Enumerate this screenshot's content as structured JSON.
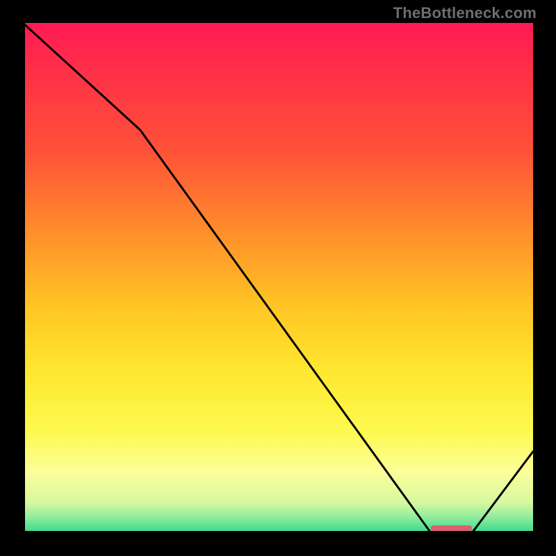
{
  "watermark": "TheBottleneck.com",
  "colors": {
    "background": "#000000",
    "watermark_text": "#6e6e6e",
    "curve": "#000000",
    "marker": "#d9606d"
  },
  "chart_data": {
    "type": "line",
    "title": "",
    "xlabel": "",
    "ylabel": "",
    "xlim": [
      0,
      100
    ],
    "ylim": [
      0,
      100
    ],
    "grid": false,
    "legend": false,
    "x": [
      0,
      23,
      80,
      88,
      100
    ],
    "values": [
      100,
      79,
      0,
      0,
      16
    ],
    "note": "x and values are in percent of plot size; y=0 means curve touches bottom (green), y=100 top (red).",
    "marker_segment": {
      "x_start": 80,
      "x_end": 88,
      "y": 0
    },
    "gradient_stops": [
      {
        "pos": 0,
        "color": "#ff1a56"
      },
      {
        "pos": 8,
        "color": "#ff2d49"
      },
      {
        "pos": 25,
        "color": "#ff5138"
      },
      {
        "pos": 40,
        "color": "#ff8a2c"
      },
      {
        "pos": 55,
        "color": "#ffc324"
      },
      {
        "pos": 68,
        "color": "#ffe72f"
      },
      {
        "pos": 80,
        "color": "#fef94f"
      },
      {
        "pos": 88,
        "color": "#fcfe9a"
      },
      {
        "pos": 94,
        "color": "#d7f8a0"
      },
      {
        "pos": 97,
        "color": "#8eec9d"
      },
      {
        "pos": 100,
        "color": "#37d78a"
      }
    ]
  }
}
